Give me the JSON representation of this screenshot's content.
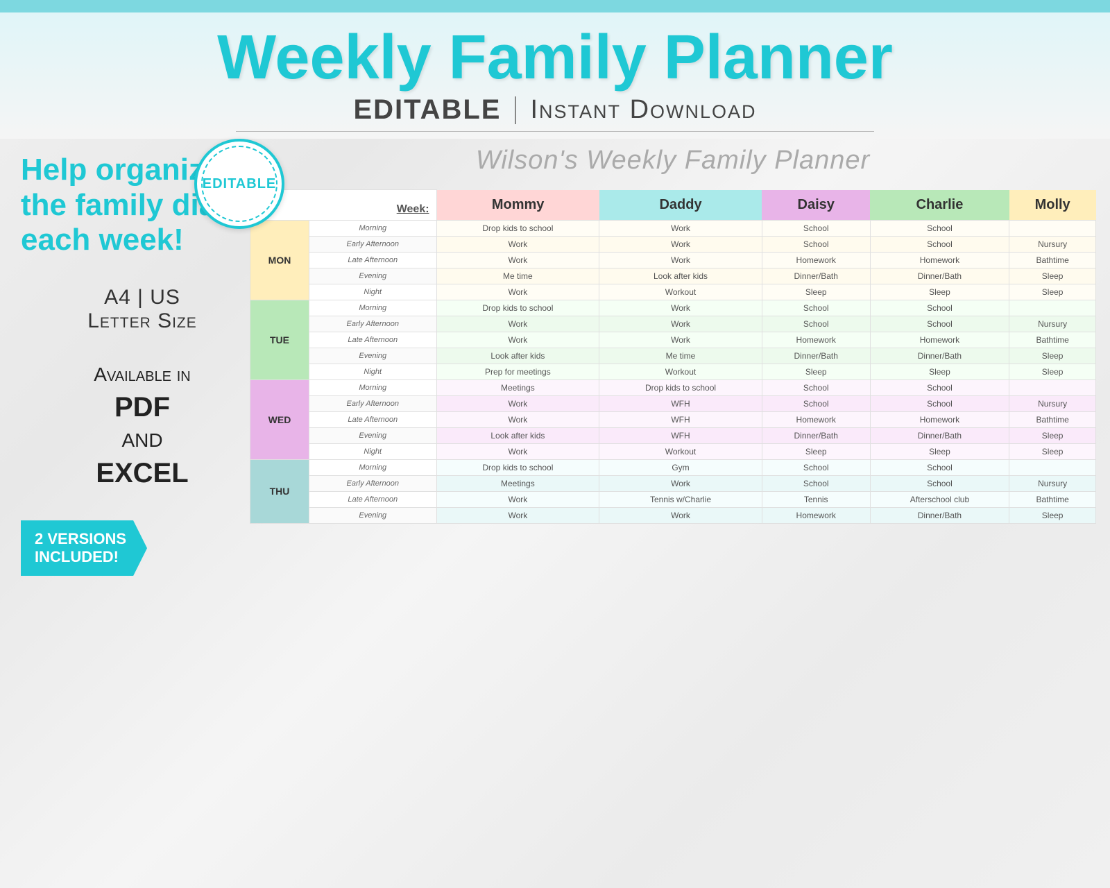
{
  "topBar": {
    "color": "#7dd8e0"
  },
  "header": {
    "title": "Weekly Family Planner",
    "editable": "EDITABLE",
    "divider": "|",
    "instant": "Instant Download"
  },
  "seal": {
    "text": "EDITABLE"
  },
  "leftPanel": {
    "helpText": "Help organize the family diary each week!",
    "sizeText": "A4 | US\nLetter Size",
    "availableText": "Available in",
    "pdfText": "PDF",
    "andText": "AND",
    "excelText": "EXCEL",
    "versionsBadge": "2 VERSIONS\nINCLUDED!"
  },
  "planner": {
    "title": "Wilson's Weekly Family Planner",
    "weekLabel": "Week:",
    "columns": [
      "Mommy",
      "Daddy",
      "Daisy",
      "Charlie",
      "Molly"
    ],
    "days": [
      {
        "name": "MON",
        "colorClass": "mon",
        "rows": [
          {
            "time": "Morning",
            "mommy": "Drop kids to school",
            "daddy": "Work",
            "daisy": "School",
            "charlie": "School",
            "molly": ""
          },
          {
            "time": "Early Afternoon",
            "mommy": "Work",
            "daddy": "Work",
            "daisy": "School",
            "charlie": "School",
            "molly": "Nursury"
          },
          {
            "time": "Late Afternoon",
            "mommy": "Work",
            "daddy": "Work",
            "daisy": "Homework",
            "charlie": "Homework",
            "molly": "Bathtime"
          },
          {
            "time": "Evening",
            "mommy": "Me time",
            "daddy": "Look after kids",
            "daisy": "Dinner/Bath",
            "charlie": "Dinner/Bath",
            "molly": "Sleep"
          },
          {
            "time": "Night",
            "mommy": "Work",
            "daddy": "Workout",
            "daisy": "Sleep",
            "charlie": "Sleep",
            "molly": "Sleep"
          }
        ]
      },
      {
        "name": "TUE",
        "colorClass": "tue",
        "rows": [
          {
            "time": "Morning",
            "mommy": "Drop kids to school",
            "daddy": "Work",
            "daisy": "School",
            "charlie": "School",
            "molly": ""
          },
          {
            "time": "Early Afternoon",
            "mommy": "Work",
            "daddy": "Work",
            "daisy": "School",
            "charlie": "School",
            "molly": "Nursury"
          },
          {
            "time": "Late Afternoon",
            "mommy": "Work",
            "daddy": "Work",
            "daisy": "Homework",
            "charlie": "Homework",
            "molly": "Bathtime"
          },
          {
            "time": "Evening",
            "mommy": "Look after kids",
            "daddy": "Me time",
            "daisy": "Dinner/Bath",
            "charlie": "Dinner/Bath",
            "molly": "Sleep"
          },
          {
            "time": "Night",
            "mommy": "Prep for meetings",
            "daddy": "Workout",
            "daisy": "Sleep",
            "charlie": "Sleep",
            "molly": "Sleep"
          }
        ]
      },
      {
        "name": "WED",
        "colorClass": "wed",
        "rows": [
          {
            "time": "Morning",
            "mommy": "Meetings",
            "daddy": "Drop kids to school",
            "daisy": "School",
            "charlie": "School",
            "molly": ""
          },
          {
            "time": "Early Afternoon",
            "mommy": "Work",
            "daddy": "WFH",
            "daisy": "School",
            "charlie": "School",
            "molly": "Nursury"
          },
          {
            "time": "Late Afternoon",
            "mommy": "Work",
            "daddy": "WFH",
            "daisy": "Homework",
            "charlie": "Homework",
            "molly": "Bathtime"
          },
          {
            "time": "Evening",
            "mommy": "Look after kids",
            "daddy": "WFH",
            "daisy": "Dinner/Bath",
            "charlie": "Dinner/Bath",
            "molly": "Sleep"
          },
          {
            "time": "Night",
            "mommy": "Work",
            "daddy": "Workout",
            "daisy": "Sleep",
            "charlie": "Sleep",
            "molly": "Sleep"
          }
        ]
      },
      {
        "name": "THU",
        "colorClass": "thu",
        "rows": [
          {
            "time": "Morning",
            "mommy": "Drop kids to school",
            "daddy": "Gym",
            "daisy": "School",
            "charlie": "School",
            "molly": ""
          },
          {
            "time": "Early Afternoon",
            "mommy": "Meetings",
            "daddy": "Work",
            "daisy": "School",
            "charlie": "School",
            "molly": "Nursury"
          },
          {
            "time": "Late Afternoon",
            "mommy": "Work",
            "daddy": "Tennis w/Charlie",
            "daisy": "Tennis",
            "charlie": "Afterschool club",
            "molly": "Bathtime"
          },
          {
            "time": "Evening",
            "mommy": "Work",
            "daddy": "Work",
            "daisy": "Homework",
            "charlie": "Dinner/Bath",
            "molly": "Sleep"
          }
        ]
      }
    ]
  }
}
